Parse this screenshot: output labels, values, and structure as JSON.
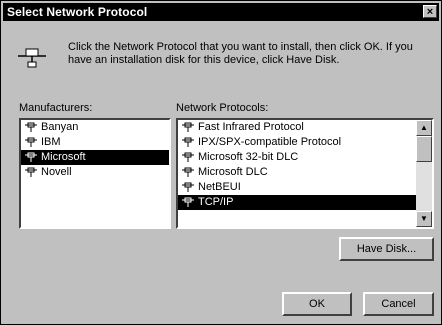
{
  "window": {
    "title": "Select Network Protocol",
    "close_glyph": "×"
  },
  "instructions": "Click the Network Protocol that you want to install, then click OK. If you have an installation disk for this device, click Have Disk.",
  "manufacturers": {
    "label": "Manufacturers:",
    "items": [
      "Banyan",
      "IBM",
      "Microsoft",
      "Novell"
    ],
    "selected_index": 2
  },
  "protocols": {
    "label": "Network Protocols:",
    "items": [
      "Fast Infrared Protocol",
      "IPX/SPX-compatible Protocol",
      "Microsoft 32-bit DLC",
      "Microsoft DLC",
      "NetBEUI",
      "TCP/IP"
    ],
    "selected_index": 5
  },
  "buttons": {
    "have_disk": "Have Disk...",
    "ok": "OK",
    "cancel": "Cancel"
  },
  "icons": {
    "network": "network-protocol-icon",
    "scroll_up": "scroll-up-arrow-icon",
    "scroll_down": "scroll-down-arrow-icon"
  },
  "colors": {
    "face": "#c0c0c0",
    "selection": "#000000",
    "titlebar": "#000000"
  }
}
